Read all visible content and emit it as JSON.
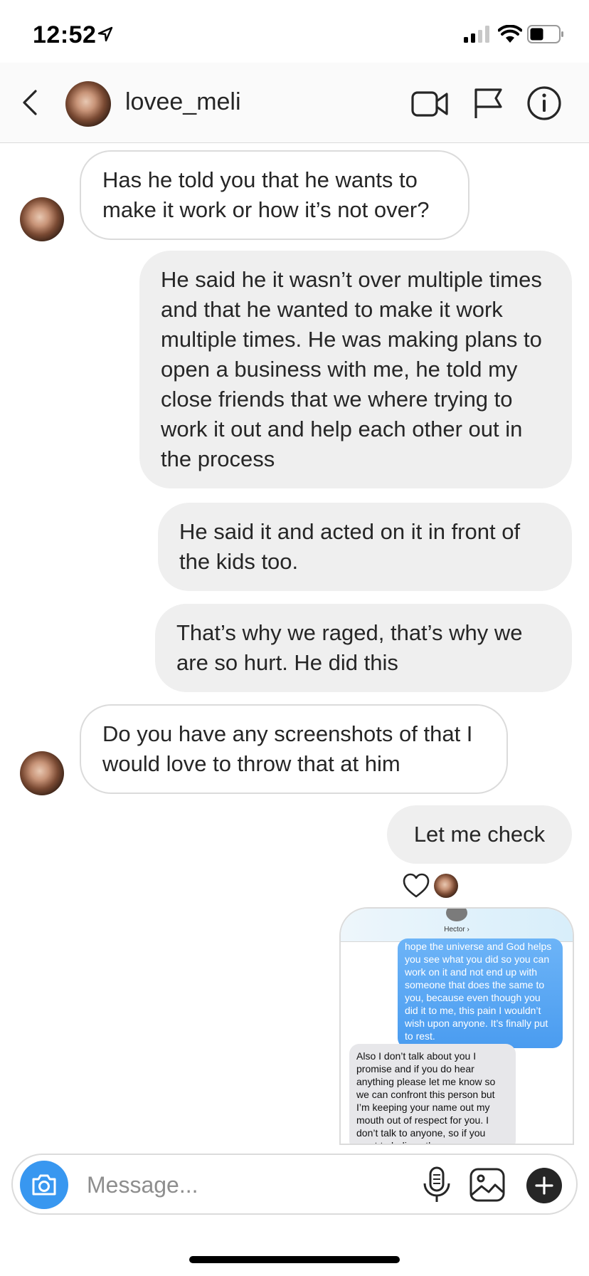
{
  "status_bar": {
    "time": "12:52"
  },
  "header": {
    "username": "lovee_meli"
  },
  "messages": [
    {
      "text": "Has he told you that he wants to make it work or how it’s not over?"
    },
    {
      "text": "He said he it wasn’t over multiple times and that he wanted to make it work multiple times. He was making plans to open a business with me, he told my close friends that we where trying to work it out and help each other out in the process"
    },
    {
      "text": "He said it and acted on it in front of the kids too."
    },
    {
      "text": "That’s why we raged, that’s why we are so hurt. He did this"
    },
    {
      "text": "Do you have any screenshots of that I would love to throw that at him"
    },
    {
      "text": "Let me check"
    }
  ],
  "attachment": {
    "contact_name": "Hector ›",
    "sent_text": "hope the universe and God helps you see what you did so you can work on it and not end up with someone that does the same to you, because even though you did it to me, this pain I wouldn’t wish upon anyone. It’s finally put to rest.",
    "received_text": "Also I don’t talk about you I promise and if you do hear anything please let me know so we can confront this person but I’m keeping your name out my mouth out of respect for you. I don’t talk to anyone, so if you want to believe them"
  },
  "composer": {
    "placeholder": "Message..."
  },
  "icons": {
    "back": "chevron-left-icon",
    "video": "video-camera-icon",
    "flag": "flag-icon",
    "info": "info-icon",
    "camera": "camera-icon",
    "mic": "microphone-icon",
    "gallery": "image-icon",
    "plus": "plus-icon",
    "heart": "heart-icon"
  },
  "colors": {
    "accent": "#3897f0",
    "imessage_blue": "#4a9cf0"
  }
}
